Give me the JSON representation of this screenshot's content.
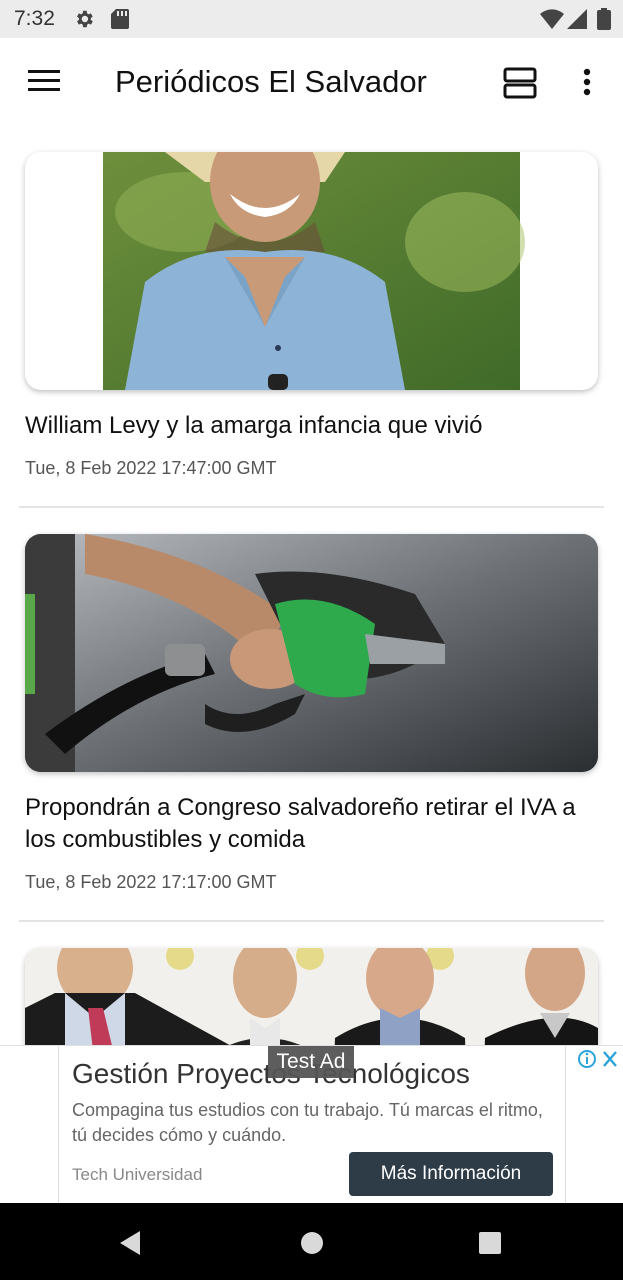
{
  "status_bar": {
    "time": "7:32",
    "icons": [
      "settings-icon",
      "sd-card-icon",
      "wifi-icon",
      "signal-icon",
      "battery-icon"
    ]
  },
  "app_bar": {
    "title": "Periódicos El Salvador",
    "icons": [
      "menu-icon",
      "view-toggle-icon",
      "more-vert-icon"
    ]
  },
  "articles": [
    {
      "headline": "William Levy y la amarga infancia que vivió",
      "date": "Tue, 8 Feb 2022 17:47:00 GMT"
    },
    {
      "headline": "Propondrán a Congreso salvadoreño retirar el IVA a los combustibles y comida",
      "date": "Tue, 8 Feb 2022 17:17:00 GMT"
    },
    {
      "headline": "",
      "date": ""
    }
  ],
  "ad": {
    "tag": "Test Ad",
    "title": "Gestión Proyectos Tecnológicos",
    "description": "Compagina tus estudios con tu trabajo. Tú marcas el ritmo, tú decides cómo y cuándo.",
    "advertiser": "Tech Universidad",
    "cta": "Más Información"
  },
  "nav_bar": {
    "icons": [
      "back-icon",
      "home-icon",
      "recents-icon"
    ]
  },
  "colors": {
    "status_bar_bg": "#ececec",
    "ad_button_bg": "#2d3c47",
    "nav_bar_bg": "#000000"
  }
}
